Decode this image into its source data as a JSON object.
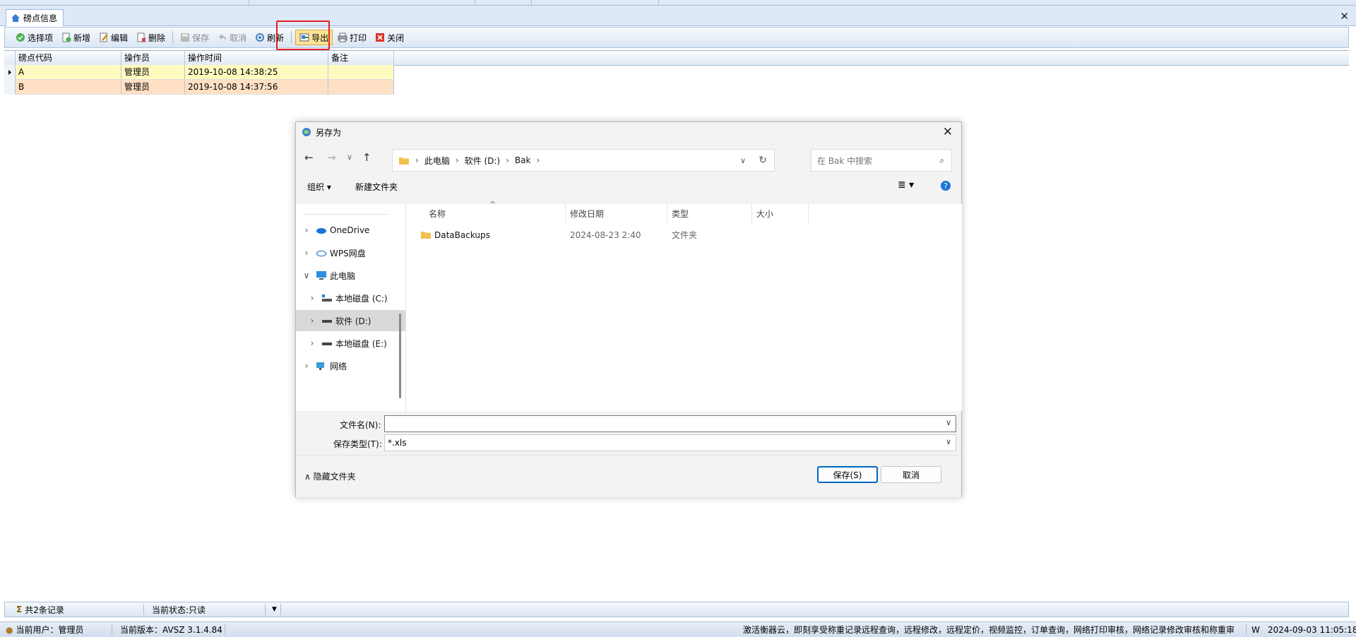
{
  "tab": {
    "label": "磅点信息"
  },
  "toolbar": {
    "select": "选择项",
    "add": "新增",
    "edit": "编辑",
    "delete": "删除",
    "save": "保存",
    "cancel": "取消",
    "refresh": "刷新",
    "export": "导出",
    "print": "打印",
    "close": "关闭"
  },
  "grid": {
    "columns": [
      "磅点代码",
      "操作员",
      "操作时间",
      "备注"
    ],
    "rows": [
      {
        "code": "A",
        "operator": "管理员",
        "time": "2019-10-08 14:38:25",
        "note": ""
      },
      {
        "code": "B",
        "operator": "管理员",
        "time": "2019-10-08 14:37:56",
        "note": ""
      }
    ]
  },
  "dialog": {
    "title": "另存为",
    "breadcrumb": [
      "此电脑",
      "软件 (D:)",
      "Bak"
    ],
    "search_placeholder": "在 Bak 中搜索",
    "organize": "组织",
    "new_folder": "新建文件夹",
    "tree": [
      "OneDrive",
      "WPS网盘",
      "此电脑",
      "本地磁盘 (C:)",
      "软件 (D:)",
      "本地磁盘 (E:)",
      "网络"
    ],
    "columns": {
      "name": "名称",
      "modified": "修改日期",
      "type": "类型",
      "size": "大小"
    },
    "files": [
      {
        "name": "DataBackups",
        "modified": "2024-08-23 2:40",
        "type": "文件夹",
        "size": ""
      }
    ],
    "filename_label": "文件名(N):",
    "filename_value": "",
    "filetype_label": "保存类型(T):",
    "filetype_value": "*.xls",
    "hide_folders": "隐藏文件夹",
    "save_btn": "保存(S)",
    "cancel_btn": "取消"
  },
  "status1": {
    "records": "共2条记录",
    "state": "当前状态:只读"
  },
  "status2": {
    "user": "当前用户：管理员",
    "version": "当前版本：AVSZ 3.1.4.84",
    "ad": "激活衡器云，即刻享受称重记录远程查询，远程修改，远程定价，视频监控，订单查询，网络打印审核，网络记录修改审核和称重审",
    "w": "W",
    "datetime": "2024-09-03 11:05:18"
  }
}
